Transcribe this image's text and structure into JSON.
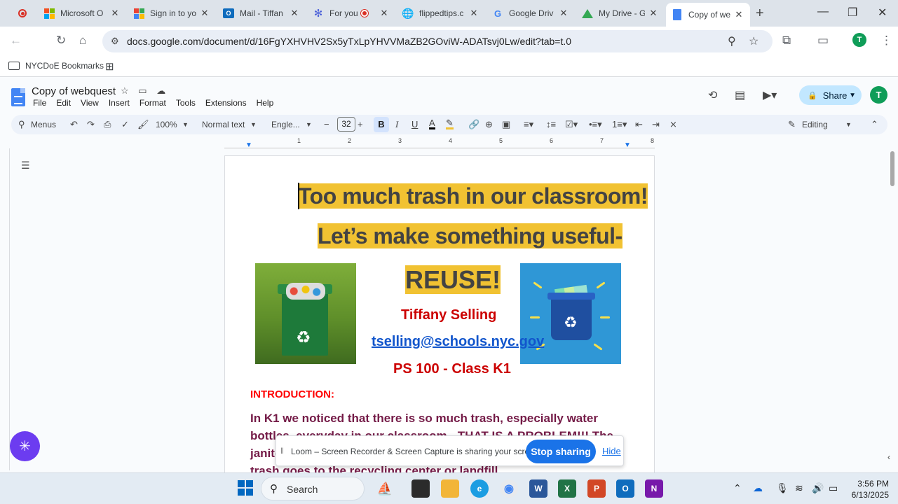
{
  "browser": {
    "tabs": [
      {
        "title": "",
        "icon": "record-icon"
      },
      {
        "title": "Microsoft O",
        "icon": "microsoft-icon"
      },
      {
        "title": "Sign in to yo",
        "icon": "google-classroom-icon"
      },
      {
        "title": "Mail - Tiffan",
        "icon": "outlook-icon"
      },
      {
        "title": "For you",
        "icon": "canva-icon"
      },
      {
        "title": "flippedtips.c",
        "icon": "globe-icon"
      },
      {
        "title": "Google Driv",
        "icon": "google-icon"
      },
      {
        "title": "My Drive - G",
        "icon": "drive-icon"
      },
      {
        "title": "Copy of webq",
        "icon": "docs-icon"
      }
    ],
    "url": "docs.google.com/document/d/16FgYXHVHV2Sx5yTxLpYHVVMaZB2GOviW-ADATsvj0Lw/edit?tab=t.0",
    "bookmark": "NYCDoE Bookmarks",
    "profile_initial": "T"
  },
  "docs": {
    "title": "Copy of webquest",
    "menus": [
      "File",
      "Edit",
      "View",
      "Insert",
      "Format",
      "Tools",
      "Extensions",
      "Help"
    ],
    "share_label": "Share",
    "avatar_initial": "T",
    "toolbar": {
      "menus_label": "Menus",
      "zoom": "100%",
      "style": "Normal text",
      "font": "Engle...",
      "font_size": "32",
      "bold": "B",
      "italic": "I",
      "underline": "U",
      "mode": "Editing"
    },
    "ruler_marks": [
      "1",
      "2",
      "3",
      "4",
      "5",
      "6",
      "7",
      "8"
    ]
  },
  "document": {
    "heading1": "Too much trash in our classroom!",
    "heading2": "Let’s make something useful-",
    "heading3": "REUSE!",
    "author": "Tiffany Selling",
    "email": "tselling@schools.nyc.gov",
    "class": "PS 100 - Class K1",
    "intro_heading": "INTRODUCTION:",
    "intro_body": "In K1 we noticed that there is so much trash, especially water bottles, everyday in our classroom - THAT IS A PROBLEM!!! The janitor asked us how we could help make less trash so that less trash goes to the recycling center or landfill."
  },
  "loom": {
    "message": "Loom – Screen Recorder & Screen Capture is sharing your screen.",
    "stop_label": "Stop sharing",
    "hide_label": "Hide"
  },
  "taskbar": {
    "search_label": "Search",
    "time": "3:56 PM",
    "date": "6/13/2025"
  },
  "colors": {
    "highlight": "#f1c232",
    "accent_blue": "#1a73e8",
    "heading_red": "#cc0000",
    "body_purple": "#741b47"
  }
}
